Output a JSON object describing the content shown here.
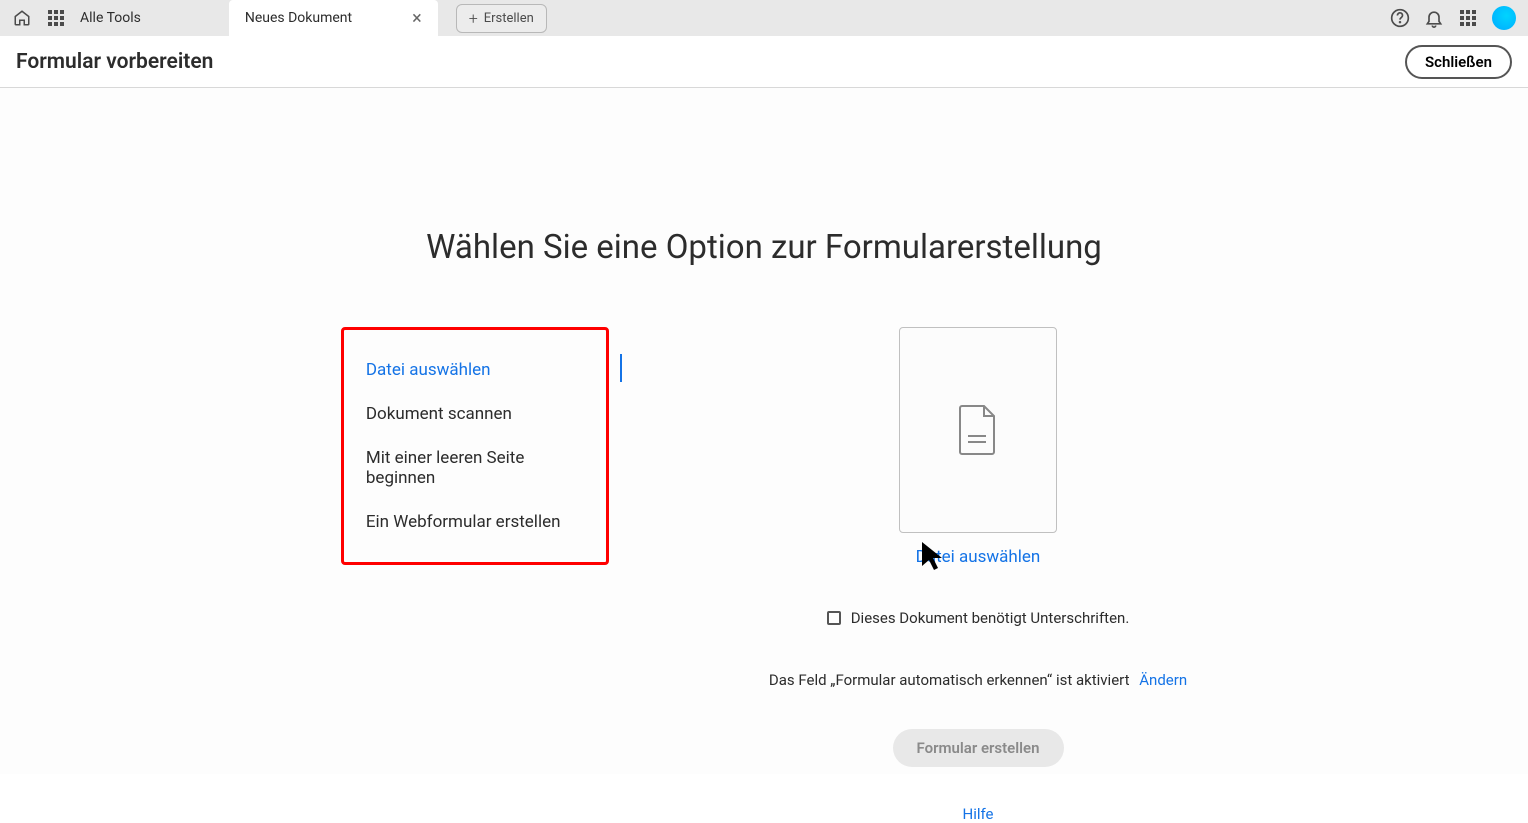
{
  "topbar": {
    "all_tools": "Alle Tools",
    "tab_title": "Neues Dokument",
    "create_label": "Erstellen"
  },
  "header": {
    "page_title": "Formular vorbereiten",
    "close_button": "Schließen"
  },
  "main": {
    "heading": "Wählen Sie eine Option zur Formularerstellung",
    "options": [
      "Datei auswählen",
      "Dokument scannen",
      "Mit einer leeren Seite beginnen",
      "Ein Webformular erstellen"
    ],
    "file_select_label": "Datei auswählen",
    "signature_checkbox_label": "Dieses Dokument benötigt Unterschriften.",
    "auto_detect_text": "Das Feld „Formular automatisch erkennen“ ist aktiviert",
    "auto_detect_link": "Ändern",
    "create_form_button": "Formular erstellen",
    "help_link": "Hilfe"
  }
}
